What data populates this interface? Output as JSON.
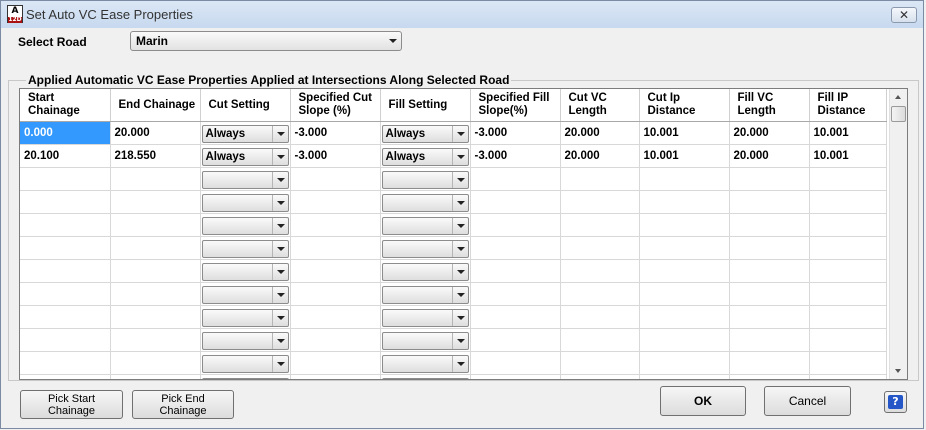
{
  "window": {
    "title": "Set Auto VC Ease Properties",
    "icon_letter": "A",
    "icon_sub": "12D",
    "close_label": "✕"
  },
  "select_road": {
    "label": "Select Road",
    "value": "Marin"
  },
  "group": {
    "title": "Applied Automatic VC Ease Properties Applied at Intersections Along Selected Road"
  },
  "table": {
    "headers": [
      {
        "l1": "Start",
        "l2": "Chainage"
      },
      {
        "l1": "End Chainage",
        "l2": ""
      },
      {
        "l1": "Cut Setting",
        "l2": ""
      },
      {
        "l1": "Specified Cut",
        "l2": "Slope (%)"
      },
      {
        "l1": "Fill Setting",
        "l2": ""
      },
      {
        "l1": "Specified Fill",
        "l2": "Slope(%)"
      },
      {
        "l1": "Cut VC",
        "l2": "Length"
      },
      {
        "l1": "Cut Ip",
        "l2": "Distance"
      },
      {
        "l1": "Fill VC",
        "l2": "Length"
      },
      {
        "l1": "Fill IP",
        "l2": "Distance"
      }
    ],
    "rows": [
      [
        "0.000",
        "20.000",
        "Always",
        "-3.000",
        "Always",
        "-3.000",
        "20.000",
        "10.001",
        "20.000",
        "10.001"
      ],
      [
        "20.100",
        "218.550",
        "Always",
        "-3.000",
        "Always",
        "-3.000",
        "20.000",
        "10.001",
        "20.000",
        "10.001"
      ],
      [
        "",
        "",
        "",
        "",
        "",
        "",
        "",
        "",
        "",
        ""
      ],
      [
        "",
        "",
        "",
        "",
        "",
        "",
        "",
        "",
        "",
        ""
      ],
      [
        "",
        "",
        "",
        "",
        "",
        "",
        "",
        "",
        "",
        ""
      ],
      [
        "",
        "",
        "",
        "",
        "",
        "",
        "",
        "",
        "",
        ""
      ],
      [
        "",
        "",
        "",
        "",
        "",
        "",
        "",
        "",
        "",
        ""
      ],
      [
        "",
        "",
        "",
        "",
        "",
        "",
        "",
        "",
        "",
        ""
      ],
      [
        "",
        "",
        "",
        "",
        "",
        "",
        "",
        "",
        "",
        ""
      ],
      [
        "",
        "",
        "",
        "",
        "",
        "",
        "",
        "",
        "",
        ""
      ],
      [
        "",
        "",
        "",
        "",
        "",
        "",
        "",
        "",
        "",
        ""
      ],
      [
        "",
        "",
        "",
        "",
        "",
        "",
        "",
        "",
        "",
        ""
      ]
    ],
    "selected_cell": {
      "row": 0,
      "col": 0
    }
  },
  "buttons": {
    "pick_start": {
      "l1": "Pick Start",
      "l2": "Chainage"
    },
    "pick_end": {
      "l1": "Pick End",
      "l2": "Chainage"
    },
    "ok": "OK",
    "cancel": "Cancel",
    "help": "?"
  },
  "colors": {
    "selection": "#3399ff"
  }
}
